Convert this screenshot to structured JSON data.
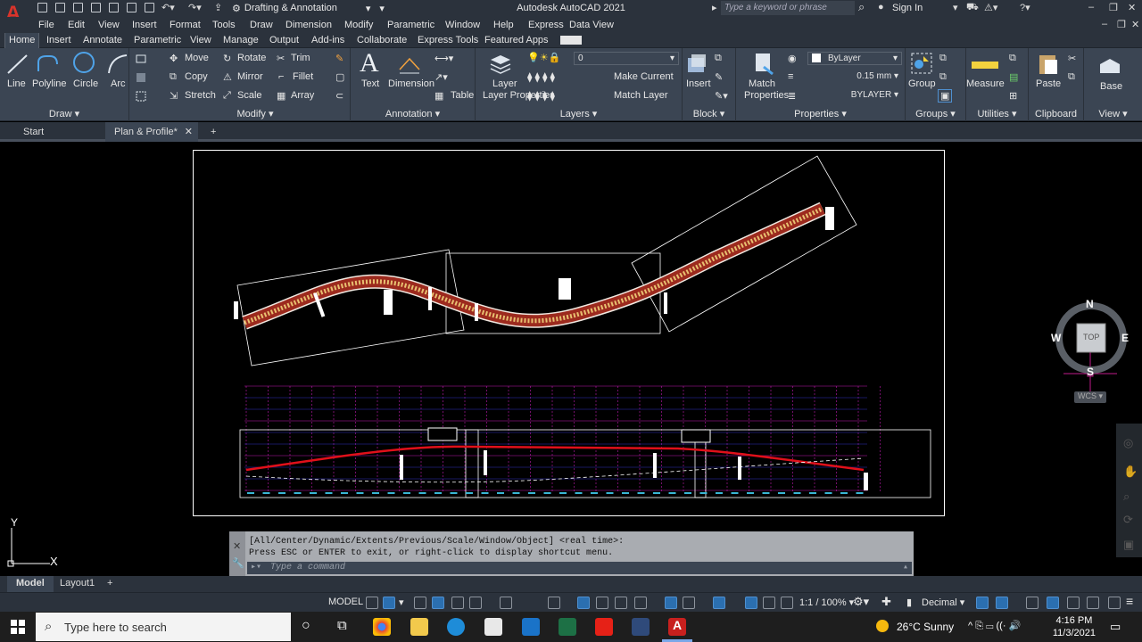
{
  "titlebar": {
    "app_logo": "A",
    "workspace": "Drafting & Annotation",
    "title": "Autodesk AutoCAD 2021",
    "search_placeholder": "Type a keyword or phrase",
    "sign_in": "Sign In"
  },
  "menubar": [
    "File",
    "Edit",
    "View",
    "Insert",
    "Format",
    "Tools",
    "Draw",
    "Dimension",
    "Modify",
    "Parametric",
    "Window",
    "Help",
    "Express",
    "Data View"
  ],
  "ribbon_tabs": [
    "Home",
    "Insert",
    "Annotate",
    "Parametric",
    "View",
    "Manage",
    "Output",
    "Add-ins",
    "Collaborate",
    "Express Tools",
    "Featured Apps"
  ],
  "ribbon": {
    "draw": {
      "title": "Draw",
      "line": "Line",
      "polyline": "Polyline",
      "circle": "Circle",
      "arc": "Arc"
    },
    "modify": {
      "title": "Modify",
      "move": "Move",
      "rotate": "Rotate",
      "trim": "Trim",
      "copy": "Copy",
      "mirror": "Mirror",
      "fillet": "Fillet",
      "stretch": "Stretch",
      "scale": "Scale",
      "array": "Array"
    },
    "annotation": {
      "title": "Annotation",
      "text": "Text",
      "dimension": "Dimension",
      "table": "Table"
    },
    "layers": {
      "title": "Layers",
      "layer_properties": "Layer Properties",
      "current_layer": "0",
      "make_current": "Make Current",
      "match_layer": "Match Layer"
    },
    "block": {
      "title": "Block",
      "insert": "Insert"
    },
    "properties": {
      "title": "Properties",
      "match": "Match Properties",
      "color": "ByLayer",
      "lineweight": "0.15 mm",
      "linetype": "BYLAYER"
    },
    "groups": {
      "title": "Groups",
      "group": "Group"
    },
    "utilities": {
      "title": "Utilities",
      "measure": "Measure"
    },
    "clipboard": {
      "title": "Clipboard",
      "paste": "Paste"
    },
    "view": {
      "title": "View",
      "base": "Base"
    }
  },
  "file_tabs": {
    "start": "Start",
    "active": "Plan & Profile*"
  },
  "viewcube": {
    "n": "N",
    "s": "S",
    "e": "E",
    "w": "W",
    "top": "TOP",
    "wcs": "WCS"
  },
  "ucs": {
    "x": "X",
    "y": "Y"
  },
  "command": {
    "history_1": "[All/Center/Dynamic/Extents/Previous/Scale/Window/Object] <real time>:",
    "history_2": "Press ESC or ENTER to exit, or right-click to display shortcut menu.",
    "placeholder": "Type a command"
  },
  "layout_tabs": [
    "Model",
    "Layout1"
  ],
  "statusbar": {
    "model": "MODEL",
    "scale": "1:1 / 100%",
    "units": "Decimal"
  },
  "taskbar": {
    "search": "Type here to search",
    "weather": "26°C  Sunny",
    "time": "4:16 PM",
    "date": "11/3/2021"
  }
}
